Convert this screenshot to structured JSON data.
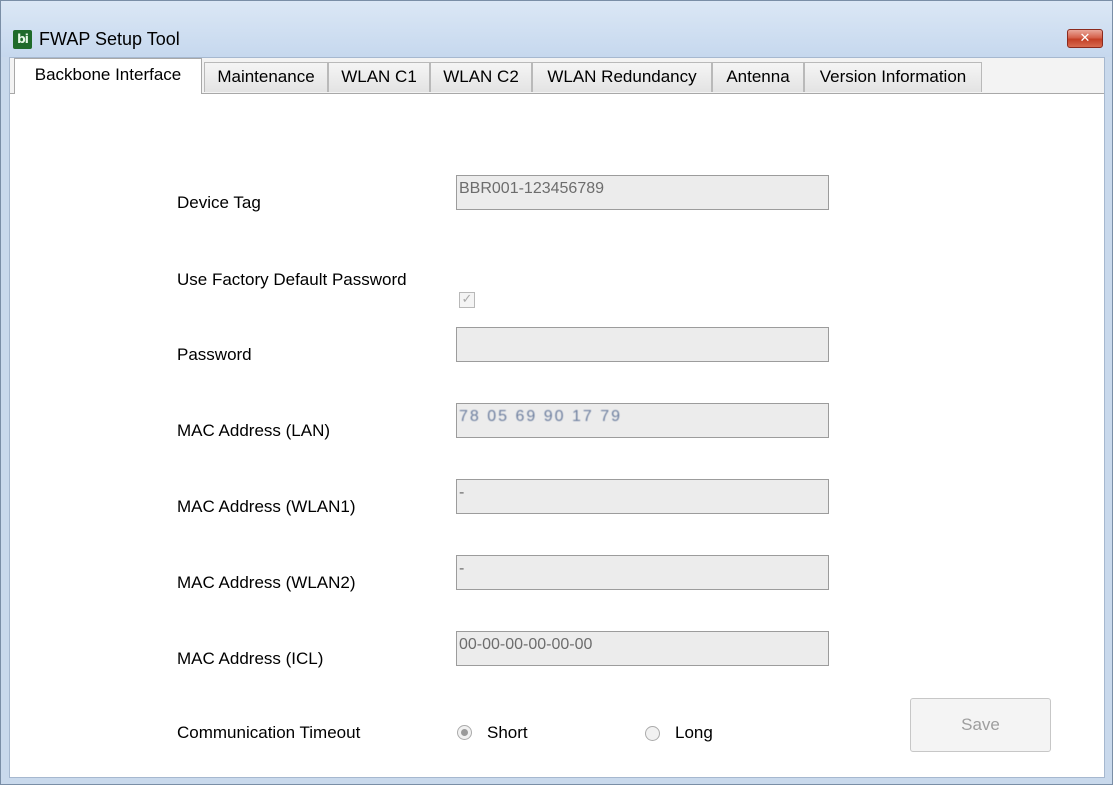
{
  "window": {
    "title": "FWAP Setup Tool",
    "icon_text": "bi",
    "close_symbol": "✕"
  },
  "tabs": [
    {
      "label": "Backbone Interface",
      "active": true
    },
    {
      "label": "Maintenance",
      "active": false
    },
    {
      "label": "WLAN C1",
      "active": false
    },
    {
      "label": "WLAN C2",
      "active": false
    },
    {
      "label": "WLAN Redundancy",
      "active": false
    },
    {
      "label": "Antenna",
      "active": false
    },
    {
      "label": "Version Information",
      "active": false
    }
  ],
  "form": {
    "device_tag": {
      "label": "Device Tag",
      "value": "BBR001-123456789"
    },
    "factory_password": {
      "label": "Use Factory Default Password",
      "checked": true,
      "check_glyph": "✓"
    },
    "password": {
      "label": "Password",
      "value": ""
    },
    "mac_lan": {
      "label": "MAC Address (LAN)",
      "value": "78 05 69 90 17 79"
    },
    "mac_wlan1": {
      "label": "MAC Address (WLAN1)",
      "value": "-"
    },
    "mac_wlan2": {
      "label": "MAC Address (WLAN2)",
      "value": "-"
    },
    "mac_icl": {
      "label": "MAC Address (ICL)",
      "value": "00-00-00-00-00-00"
    },
    "timeout": {
      "label": "Communication Timeout",
      "options": [
        {
          "label": "Short",
          "selected": true
        },
        {
          "label": "Long",
          "selected": false
        }
      ]
    }
  },
  "buttons": {
    "save_label": "Save"
  },
  "colors": {
    "title_bar": "#c6d8ee",
    "close_button": "#c33f26",
    "field_background": "#ececec",
    "disabled_text": "#9e9e9e"
  }
}
